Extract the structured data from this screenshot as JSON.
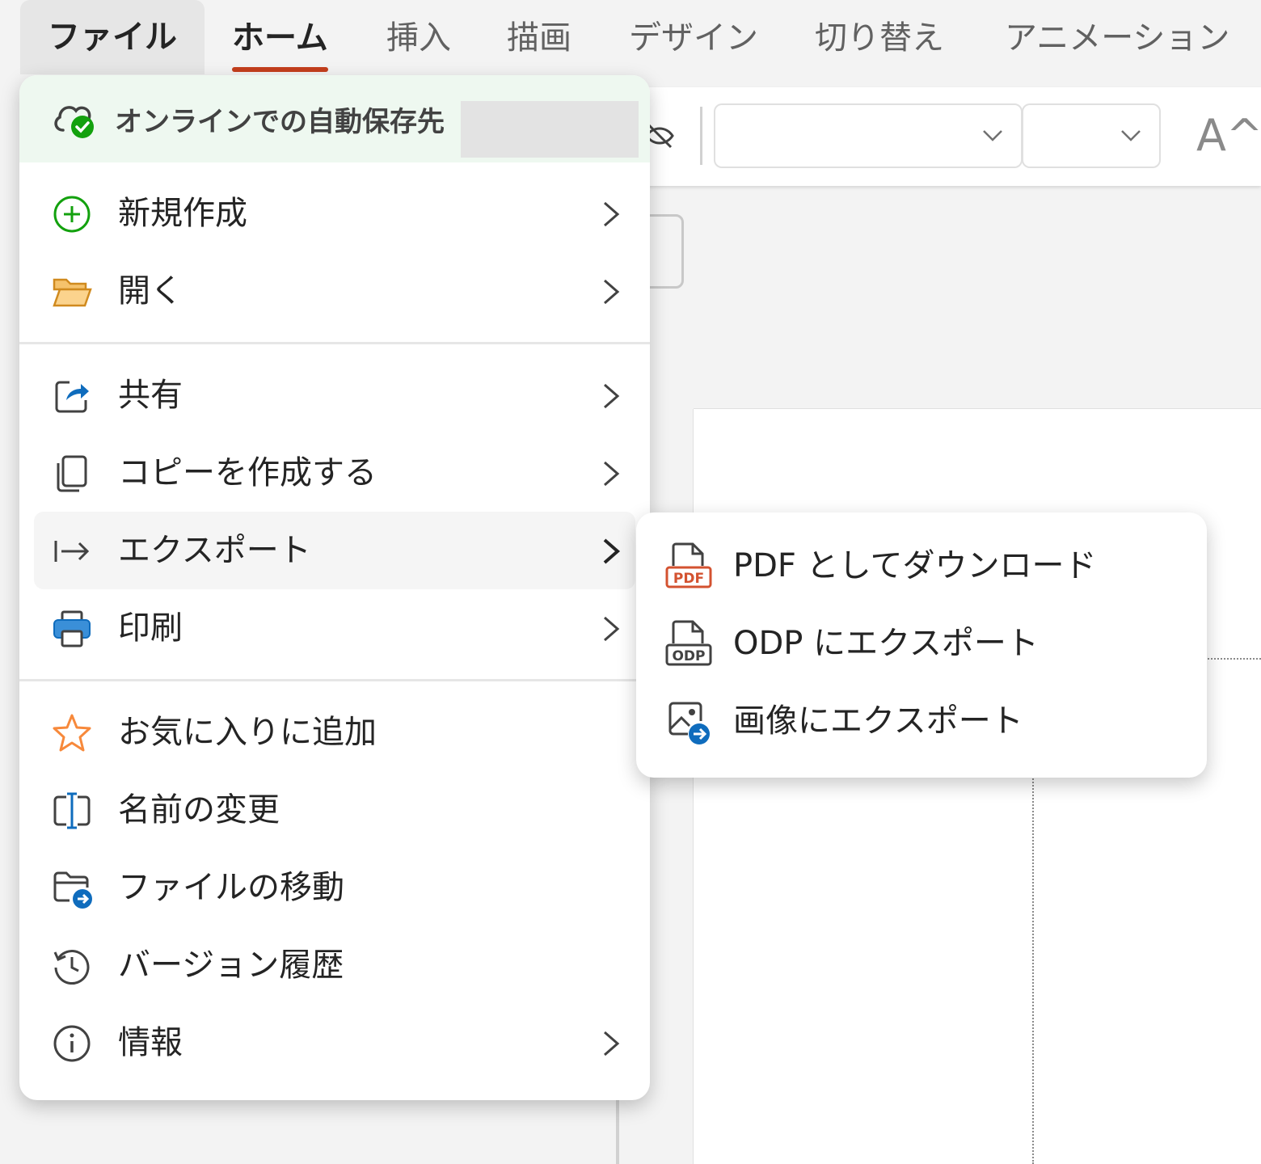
{
  "tabs": [
    "ファイル",
    "ホーム",
    "挿入",
    "描画",
    "デザイン",
    "切り替え",
    "アニメーション"
  ],
  "active_tab": "ホーム",
  "open_tab": "ファイル",
  "accent_color": "#c43e1c",
  "autosave": {
    "label": "オンラインでの自動保存先",
    "icon": "cloud-check-icon"
  },
  "menu": {
    "new": {
      "label": "新規作成",
      "icon": "add-circle-icon"
    },
    "open": {
      "label": "開く",
      "icon": "folder-open-icon"
    },
    "share": {
      "label": "共有",
      "icon": "share-icon"
    },
    "copy": {
      "label": "コピーを作成する",
      "icon": "copy-icon"
    },
    "export": {
      "label": "エクスポート",
      "icon": "export-arrow-icon"
    },
    "print": {
      "label": "印刷",
      "icon": "printer-icon"
    },
    "favorite": {
      "label": "お気に入りに追加",
      "icon": "star-icon"
    },
    "rename": {
      "label": "名前の変更",
      "icon": "rename-icon"
    },
    "move": {
      "label": "ファイルの移動",
      "icon": "folder-move-icon"
    },
    "history": {
      "label": "バージョン履歴",
      "icon": "history-icon"
    },
    "info": {
      "label": "情報",
      "icon": "info-icon"
    }
  },
  "export_submenu": {
    "pdf": {
      "label": "PDF としてダウンロード",
      "icon": "pdf-file-icon"
    },
    "odp": {
      "label": "ODP にエクスポート",
      "icon": "odp-file-icon"
    },
    "image": {
      "label": "画像にエクスポート",
      "icon": "image-export-icon"
    }
  },
  "ribbon": {
    "font_grow_icon": "A^"
  }
}
